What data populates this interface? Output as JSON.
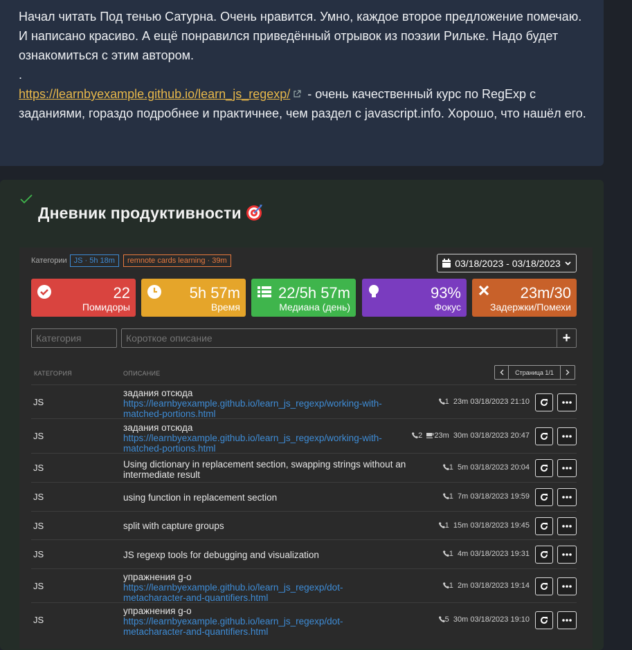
{
  "note": {
    "top_dot": ".",
    "paragraph1": "Начал читать Под тенью Сатурна. Очень нравится. Умно, каждое второе предложение помечаю. И написано красиво. А ещё понравился приведённый отрывок из поэзии Рильке. Надо будет ознакомиться с этим автором.",
    "separator": ".",
    "link_text": "https://learnbyexample.github.io/learn_js_regexp/",
    "paragraph2_rest": " - очень качественный курс по RegExp с заданиями, гораздо подробнее и практичнее, чем раздел с javascript.info. Хорошо, что нашёл его."
  },
  "productivity": {
    "title": "Дневник продуктивности",
    "categories_label": "Категории",
    "chips": [
      "JS · 5h 18m",
      "remnote cards learning · 39m"
    ],
    "date_range": "03/18/2023 - 03/18/2023",
    "stats": [
      {
        "value": "22",
        "label": "Помидоры",
        "icon": "check-circle-icon",
        "color": "#d9443f"
      },
      {
        "value": "5h 57m",
        "label": "Время",
        "icon": "clock-icon",
        "color": "#e5a52a"
      },
      {
        "value": "22/5h 57m",
        "label": "Медиана (день)",
        "icon": "list-icon",
        "color": "#3fb54c"
      },
      {
        "value": "93%",
        "label": "Фокус",
        "icon": "lightbulb-icon",
        "color": "#7a3cbf"
      },
      {
        "value": "23m/30",
        "label": "Задержки/Помехи",
        "icon": "times-icon",
        "color": "#c8612a"
      }
    ],
    "category_placeholder": "Категория",
    "description_placeholder": "Короткое описание",
    "add_label": "+",
    "col_category": "КАТЕГОРИЯ",
    "col_description": "ОПИСАНИЕ",
    "page_label": "Страница 1/1",
    "rows": [
      {
        "cat": "JS",
        "text": "задания отсюда",
        "link": "https://learnbyexample.github.io/learn_js_regexp/working-with-matched-portions.html",
        "calls": "1",
        "breaks": "",
        "duration": "23m",
        "datetime": "03/18/2023 21:10"
      },
      {
        "cat": "JS",
        "text": "задания отсюда",
        "link": "https://learnbyexample.github.io/learn_js_regexp/working-with-matched-portions.html",
        "calls": "2",
        "breaks": "23m",
        "duration": "30m",
        "datetime": "03/18/2023 20:47"
      },
      {
        "cat": "JS",
        "text": "Using dictionary in replacement section, swapping strings without an intermediate result",
        "link": "",
        "calls": "1",
        "breaks": "",
        "duration": "5m",
        "datetime": "03/18/2023 20:04"
      },
      {
        "cat": "JS",
        "text": "using function in replacement section",
        "link": "",
        "calls": "1",
        "breaks": "",
        "duration": "7m",
        "datetime": "03/18/2023 19:59"
      },
      {
        "cat": "JS",
        "text": "split with capture groups",
        "link": "",
        "calls": "1",
        "breaks": "",
        "duration": "15m",
        "datetime": "03/18/2023 19:45"
      },
      {
        "cat": "JS",
        "text": "JS regexp tools for debugging and visualization",
        "link": "",
        "calls": "1",
        "breaks": "",
        "duration": "4m",
        "datetime": "03/18/2023 19:31"
      },
      {
        "cat": "JS",
        "text": "упражнения g-o",
        "link": "https://learnbyexample.github.io/learn_js_regexp/dot-metacharacter-and-quantifiers.html",
        "calls": "1",
        "breaks": "",
        "duration": "2m",
        "datetime": "03/18/2023 19:14"
      },
      {
        "cat": "JS",
        "text": "упражнения g-o",
        "link": "https://learnbyexample.github.io/learn_js_regexp/dot-metacharacter-and-quantifiers.html",
        "calls": "5",
        "breaks": "",
        "duration": "30m",
        "datetime": "03/18/2023 19:10"
      }
    ]
  }
}
